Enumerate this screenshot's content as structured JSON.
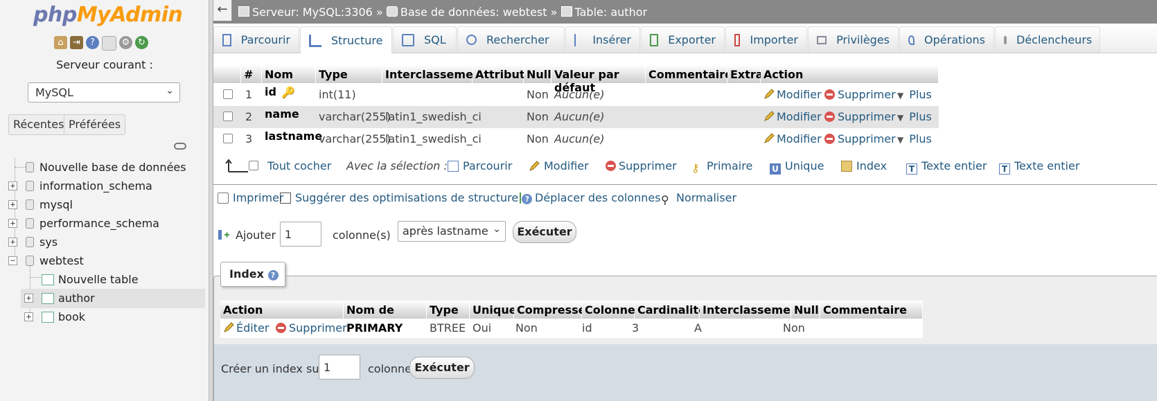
{
  "sidebar": {
    "logo_php": "php",
    "logo_ma": "MyAdmin",
    "server_label": "Serveur courant :",
    "server_value": "MySQL",
    "recent_label": "Récentes",
    "favorites_label": "Préférées",
    "tree": [
      {
        "label": "Nouvelle base de données"
      },
      {
        "label": "information_schema"
      },
      {
        "label": "mysql"
      },
      {
        "label": "performance_schema"
      },
      {
        "label": "sys"
      },
      {
        "label": "webtest"
      },
      {
        "label": "Nouvelle table"
      },
      {
        "label": "author"
      },
      {
        "label": "book"
      }
    ]
  },
  "breadcrumb": {
    "server": "Serveur: MySQL:3306",
    "sep1": "»",
    "database": "Base de données: webtest",
    "sep2": "»",
    "table": "Table: author"
  },
  "tabs": [
    "Parcourir",
    "Structure",
    "SQL",
    "Rechercher",
    "Insérer",
    "Exporter",
    "Importer",
    "Privilèges",
    "Opérations",
    "Déclencheurs"
  ],
  "active_tab": "Structure",
  "structure": {
    "headers": [
      "#",
      "Nom",
      "Type",
      "Interclassement",
      "Attributs",
      "Null",
      "Valeur par défaut",
      "Commentaires",
      "Extra",
      "Action"
    ],
    "rows": [
      {
        "num": "1",
        "name": "id",
        "type": "int(11)",
        "collation": "",
        "null": "Non",
        "default": "Aucun(e)"
      },
      {
        "num": "2",
        "name": "name",
        "type": "varchar(255)",
        "collation": "latin1_swedish_ci",
        "null": "Non",
        "default": "Aucun(e)"
      },
      {
        "num": "3",
        "name": "lastname",
        "type": "varchar(255)",
        "collation": "latin1_swedish_ci",
        "null": "Non",
        "default": "Aucun(e)"
      }
    ],
    "action_modify": "Modifier",
    "action_delete": "Supprimer",
    "action_more": "Plus"
  },
  "selection": {
    "check_all": "Tout cocher",
    "with_selection": "Avec la sélection :",
    "browse": "Parcourir",
    "modify": "Modifier",
    "delete": "Supprimer",
    "primary": "Primaire",
    "unique": "Unique",
    "index": "Index",
    "fulltext1": "Texte entier",
    "fulltext2": "Texte entier"
  },
  "tools": {
    "print": "Imprimer",
    "suggest": "Suggérer des optimisations de structure",
    "move": "Déplacer des colonnes",
    "normalize": "Normaliser"
  },
  "add_columns": {
    "label": "Ajouter",
    "count": "1",
    "unit": "colonne(s)",
    "position": "après lastname",
    "go": "Exécuter"
  },
  "indexes": {
    "legend": "Index",
    "headers": [
      "Action",
      "Nom de l'index",
      "Type",
      "Unique",
      "Compressé",
      "Colonne",
      "Cardinalité",
      "Interclassement",
      "Null",
      "Commentaire"
    ],
    "row": {
      "edit": "Éditer",
      "delete": "Supprimer",
      "name": "PRIMARY",
      "type": "BTREE",
      "unique": "Oui",
      "packed": "Non",
      "column": "id",
      "cardinality": "3",
      "collation": "A",
      "null": "Non",
      "comment": ""
    },
    "create_label": "Créer un index sur",
    "create_count": "1",
    "create_unit": "colonnes",
    "create_go": "Exécuter"
  }
}
